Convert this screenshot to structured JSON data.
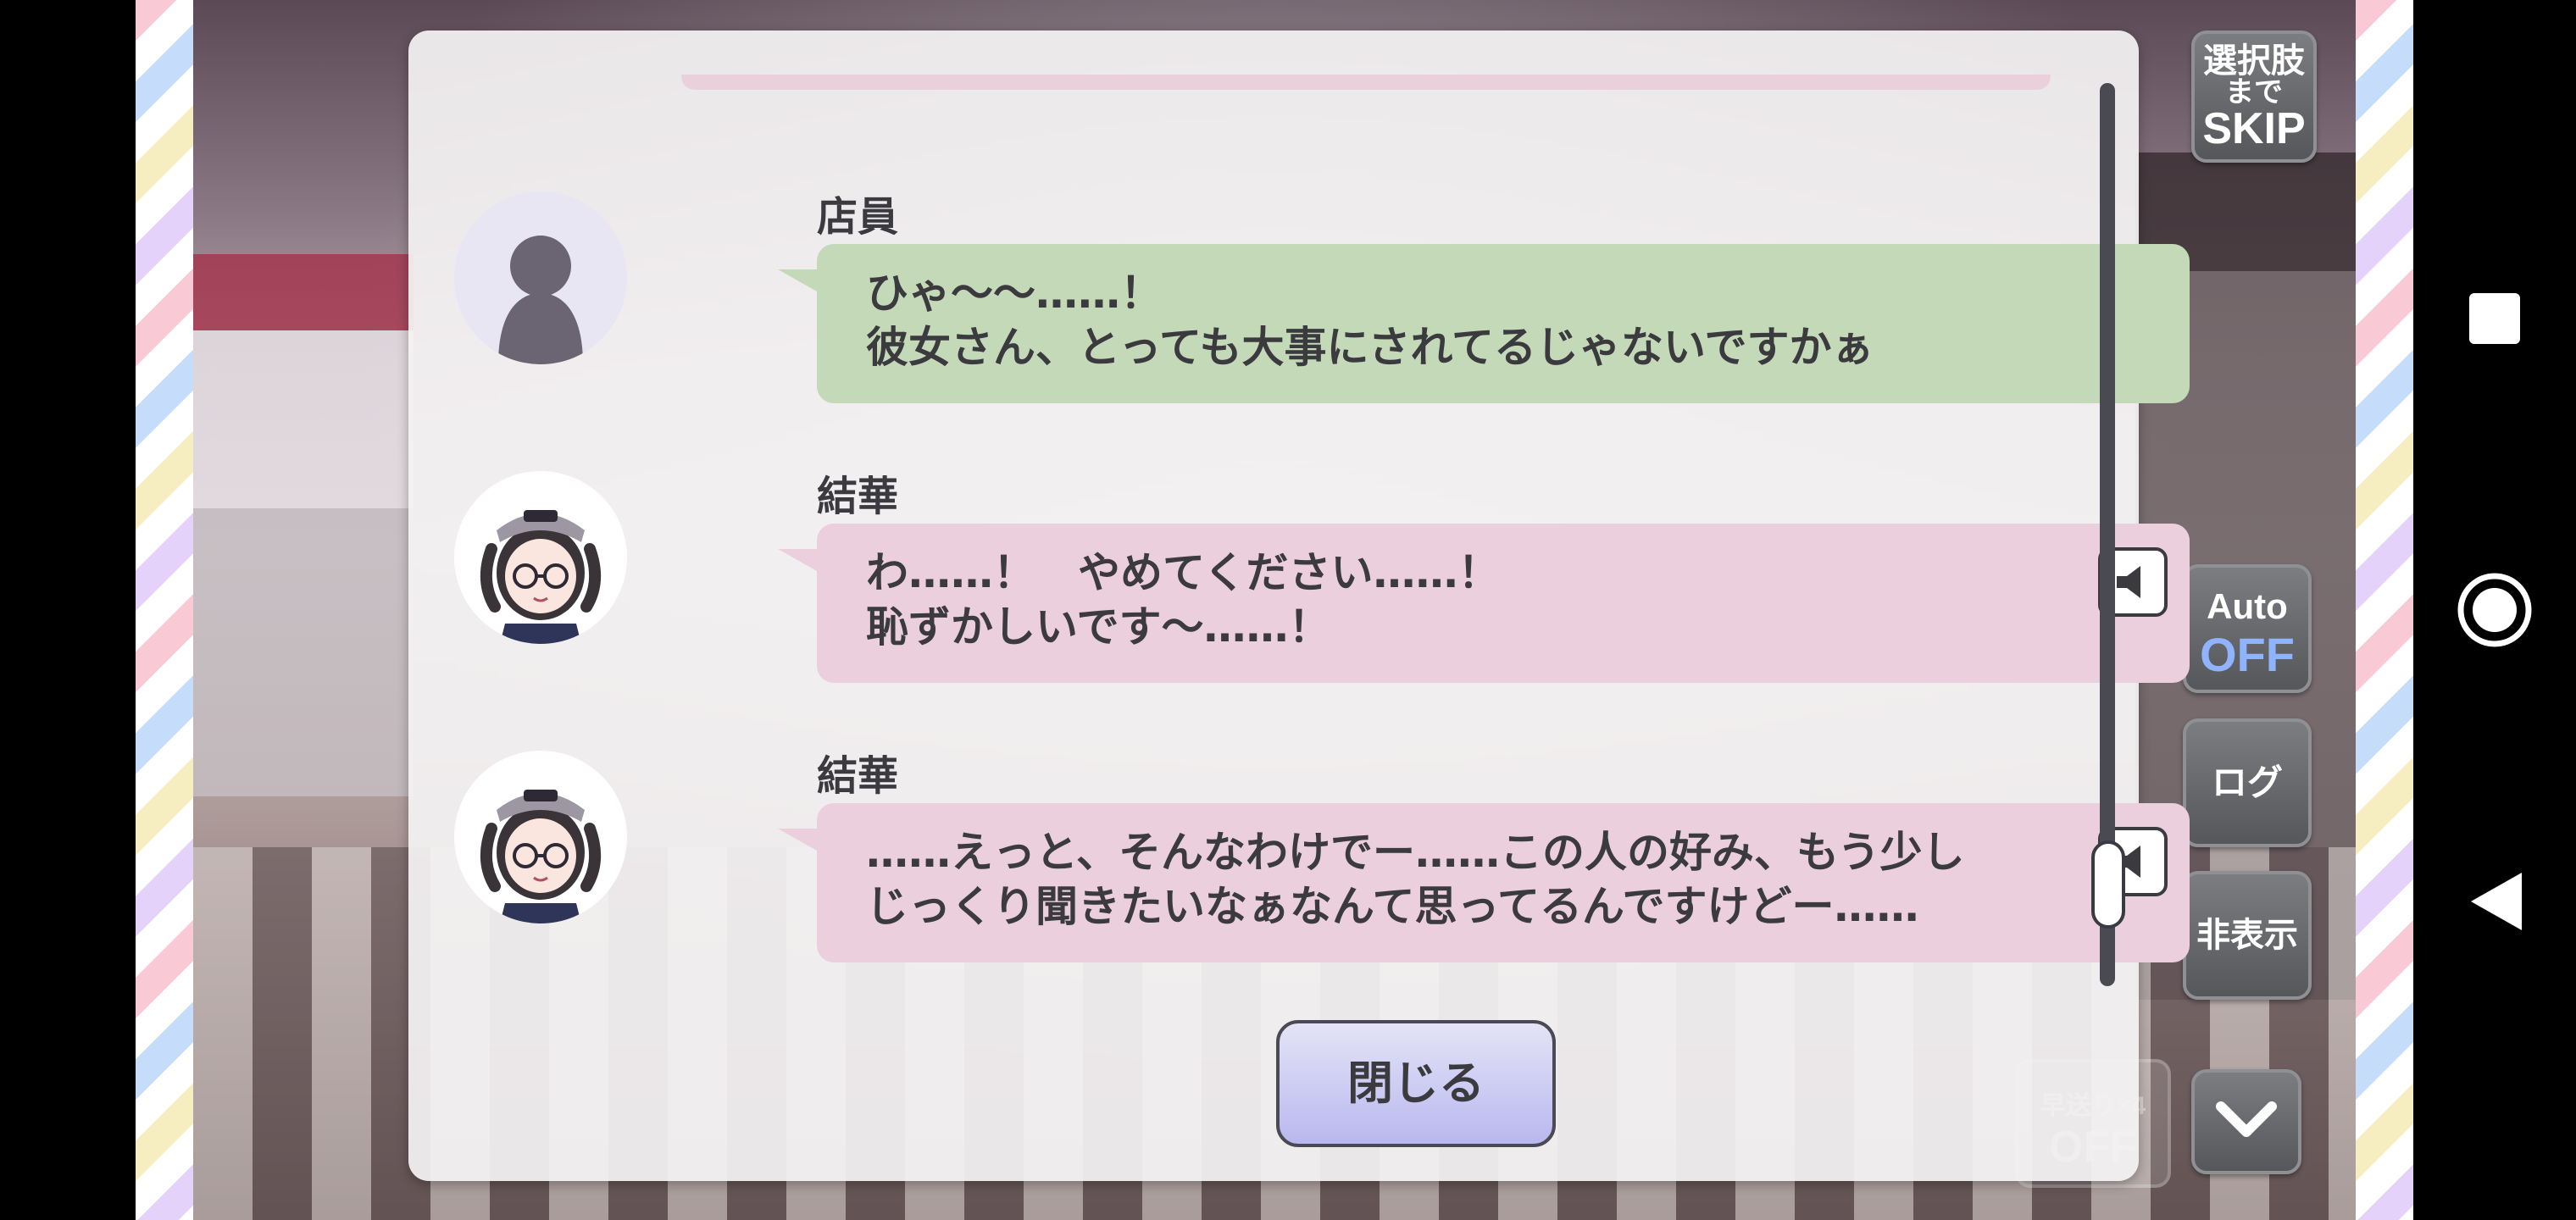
{
  "log": {
    "entries": [
      {
        "speaker": "店員",
        "lines": [
          "ひゃ〜〜……！",
          "彼女さん、とっても大事にされてるじゃないですかぁ"
        ],
        "color": "#c4d9b7",
        "avatar": "silhouette-avatar",
        "has_voice": false
      },
      {
        "speaker": "結華",
        "lines": [
          "わ……！　やめてください……！",
          "恥ずかしいです〜……！"
        ],
        "color": "#ebcfdc",
        "avatar": "yuika-avatar",
        "has_voice": true
      },
      {
        "speaker": "結華",
        "lines": [
          "……えっと、そんなわけでー……この人の好み、もう少し",
          "じっくり聞きたいなぁなんて思ってるんですけどー……"
        ],
        "color": "#ebcfdc",
        "avatar": "yuika-avatar",
        "has_voice": true
      }
    ],
    "close_label": "閉じる"
  },
  "controls": {
    "skip": {
      "line1": "選択肢",
      "line2": "まで",
      "line3": "SKIP"
    },
    "auto": {
      "label": "Auto",
      "state": "OFF"
    },
    "log_label": "ログ",
    "hide_label": "非表示",
    "fast_forward": {
      "label": "早送り×4",
      "state": "OFF"
    }
  },
  "android_nav": {
    "icons": [
      "recents-square-icon",
      "home-circle-icon",
      "back-triangle-icon"
    ]
  },
  "colors": {
    "green_bubble": "#c4d9b7",
    "pink_bubble": "#ebcfdc",
    "auto_off": "#8fb3ff"
  }
}
